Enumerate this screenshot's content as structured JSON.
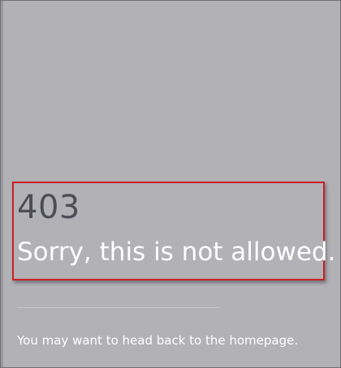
{
  "error": {
    "code": "403",
    "message": "Sorry, this is not allowed.",
    "hint": "You may want to head back to the homepage."
  },
  "colors": {
    "background": "#b1b1b6",
    "code_text": "#4d4d56",
    "message_text": "#ffffff",
    "highlight_border": "#cc1f22",
    "divider": "#c7c7cc"
  }
}
